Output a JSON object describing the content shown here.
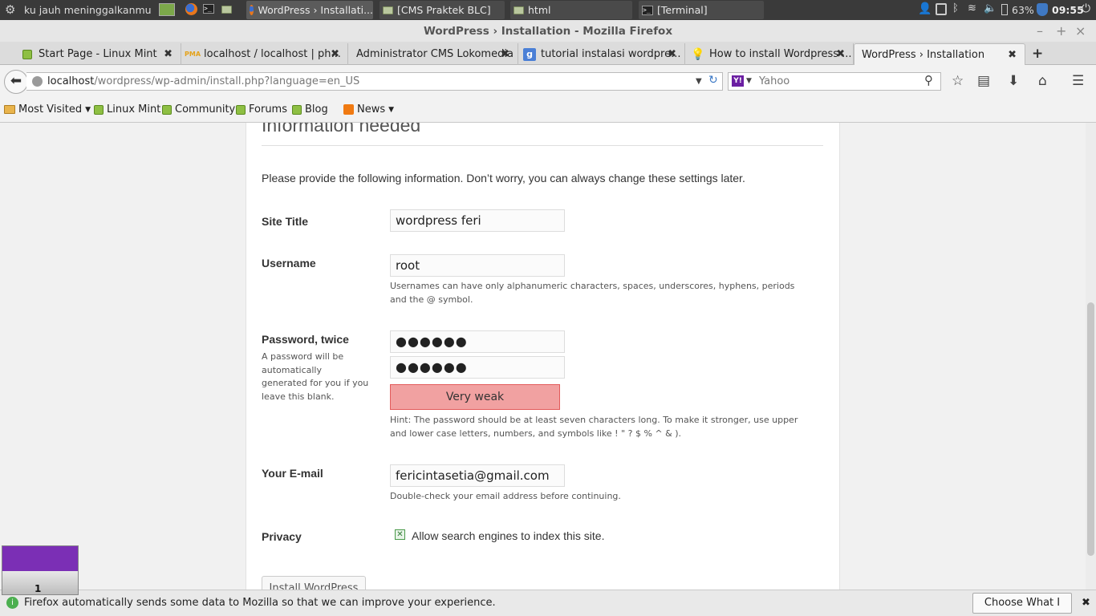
{
  "panel": {
    "menu_label": "ku jauh meninggalkanmu",
    "tasks": [
      {
        "label": "WordPress › Installati...",
        "icon": "firefox-icon"
      },
      {
        "label": "[CMS Praktek BLC]",
        "icon": "folder-icon"
      },
      {
        "label": "html",
        "icon": "folder-icon"
      },
      {
        "label": "[Terminal]",
        "icon": "terminal-icon"
      }
    ],
    "battery": "63%",
    "clock": "09:55"
  },
  "window": {
    "title": "WordPress › Installation - Mozilla Firefox"
  },
  "tabs": [
    {
      "label": "Start Page - Linux Mint"
    },
    {
      "label": "localhost / localhost | ph..."
    },
    {
      "label": "Administrator CMS Lokomedia"
    },
    {
      "label": "tutorial instalasi wordpre..."
    },
    {
      "label": "How to install Wordpress ..."
    },
    {
      "label": "WordPress › Installation"
    }
  ],
  "nav": {
    "url_host": "localhost",
    "url_path": "/wordpress/wp-admin/install.php?language=en_US",
    "search_placeholder": "Yahoo"
  },
  "bookmarks": [
    {
      "label": "Most Visited"
    },
    {
      "label": "Linux Mint"
    },
    {
      "label": "Community"
    },
    {
      "label": "Forums"
    },
    {
      "label": "Blog"
    },
    {
      "label": "News"
    }
  ],
  "form": {
    "heading": "Information needed",
    "intro": "Please provide the following information. Don’t worry, you can always change these settings later.",
    "site_title_label": "Site Title",
    "site_title_value": "wordpress feri",
    "username_label": "Username",
    "username_value": "root",
    "username_desc": "Usernames can have only alphanumeric characters, spaces, underscores, hyphens, periods and the @ symbol.",
    "password_label": "Password, twice",
    "password_desc": "A password will be automatically generated for you if you leave this blank.",
    "password1": "●●●●●●",
    "password2": "●●●●●●",
    "strength": "Very weak",
    "hint": "Hint: The password should be at least seven characters long. To make it stronger, use upper and lower case letters, numbers, and symbols like ! \" ? $ % ^ & ).",
    "email_label": "Your E-mail",
    "email_value": "fericintasetia@gmail.com",
    "email_desc": "Double-check your email address before continuing.",
    "privacy_label": "Privacy",
    "privacy_text": "Allow search engines to index this site.",
    "submit": "Install WordPress"
  },
  "notification": {
    "text": "Firefox automatically sends some data to Mozilla so that we can improve your experience.",
    "button": "Choose What I Share"
  },
  "workspace": {
    "number": "1"
  }
}
